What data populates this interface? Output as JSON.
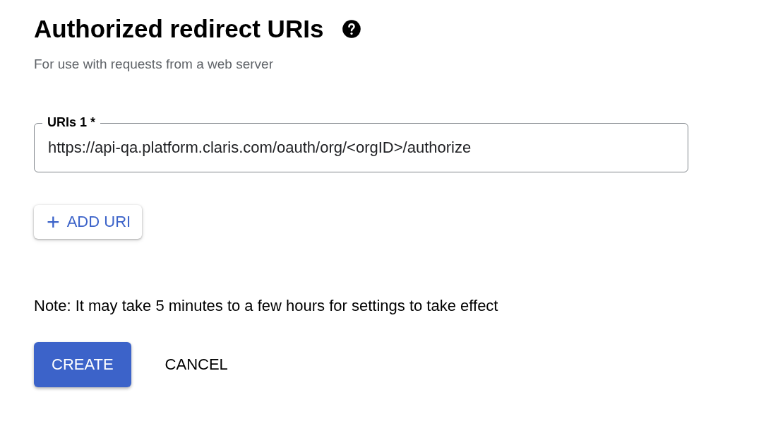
{
  "section": {
    "title": "Authorized redirect URIs",
    "subtitle": "For use with requests from a web server"
  },
  "uris": [
    {
      "label": "URIs 1 *",
      "value": "https://api-qa.platform.claris.com/oauth/org/<orgID>/authorize"
    }
  ],
  "add_button": {
    "icon": "+",
    "label": "ADD URI"
  },
  "note": "Note: It may take 5 minutes to a few hours for settings to take effect",
  "actions": [
    {
      "label": "CREATE",
      "kind": "primary"
    },
    {
      "label": "CANCEL",
      "kind": "text"
    }
  ]
}
